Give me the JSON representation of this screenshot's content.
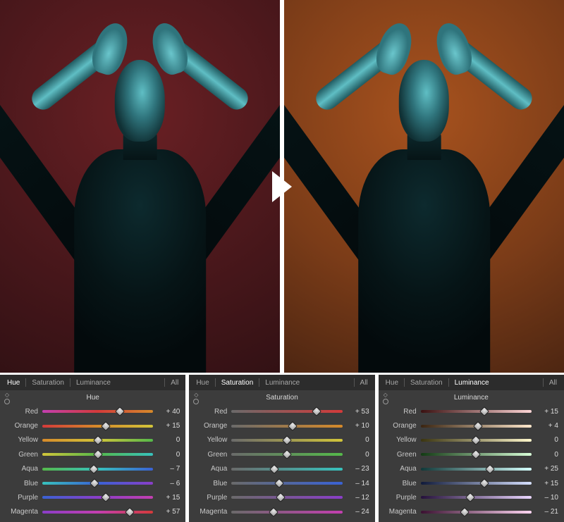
{
  "comparison_arrow": true,
  "panels": [
    {
      "tabs": [
        "Hue",
        "Saturation",
        "Luminance"
      ],
      "active_tab": "Hue",
      "all_label": "All",
      "section_title": "Hue",
      "rows": [
        {
          "label": "Red",
          "value": 40,
          "display": "+ 40"
        },
        {
          "label": "Orange",
          "value": 15,
          "display": "+ 15"
        },
        {
          "label": "Yellow",
          "value": 0,
          "display": "0"
        },
        {
          "label": "Green",
          "value": 0,
          "display": "0"
        },
        {
          "label": "Aqua",
          "value": -7,
          "display": "– 7"
        },
        {
          "label": "Blue",
          "value": -6,
          "display": "– 6"
        },
        {
          "label": "Purple",
          "value": 15,
          "display": "+ 15"
        },
        {
          "label": "Magenta",
          "value": 57,
          "display": "+ 57"
        }
      ]
    },
    {
      "tabs": [
        "Hue",
        "Saturation",
        "Luminance"
      ],
      "active_tab": "Saturation",
      "all_label": "All",
      "section_title": "Saturation",
      "rows": [
        {
          "label": "Red",
          "value": 53,
          "display": "+ 53"
        },
        {
          "label": "Orange",
          "value": 10,
          "display": "+ 10"
        },
        {
          "label": "Yellow",
          "value": 0,
          "display": "0"
        },
        {
          "label": "Green",
          "value": 0,
          "display": "0"
        },
        {
          "label": "Aqua",
          "value": -23,
          "display": "– 23"
        },
        {
          "label": "Blue",
          "value": -14,
          "display": "– 14"
        },
        {
          "label": "Purple",
          "value": -12,
          "display": "– 12"
        },
        {
          "label": "Magenta",
          "value": -24,
          "display": "– 24"
        }
      ]
    },
    {
      "tabs": [
        "Hue",
        "Saturation",
        "Luminance"
      ],
      "active_tab": "Luminance",
      "all_label": "All",
      "section_title": "Luminance",
      "rows": [
        {
          "label": "Red",
          "value": 15,
          "display": "+ 15"
        },
        {
          "label": "Orange",
          "value": 4,
          "display": "+ 4"
        },
        {
          "label": "Yellow",
          "value": 0,
          "display": "0"
        },
        {
          "label": "Green",
          "value": 0,
          "display": "0"
        },
        {
          "label": "Aqua",
          "value": 25,
          "display": "+ 25"
        },
        {
          "label": "Blue",
          "value": 15,
          "display": "+ 15"
        },
        {
          "label": "Purple",
          "value": -10,
          "display": "– 10"
        },
        {
          "label": "Magenta",
          "value": -21,
          "display": "– 21"
        }
      ]
    }
  ],
  "gradients": {
    "hue": {
      "Red": [
        "#c33fb0",
        "#d43a3a",
        "#d68a2a"
      ],
      "Orange": [
        "#d43a3a",
        "#d68a2a",
        "#d2c53a"
      ],
      "Yellow": [
        "#d68a2a",
        "#d2c53a",
        "#55b94a"
      ],
      "Green": [
        "#d2c53a",
        "#55b94a",
        "#37c2bd"
      ],
      "Aqua": [
        "#55b94a",
        "#37c2bd",
        "#3a62d4"
      ],
      "Blue": [
        "#37c2bd",
        "#3a62d4",
        "#8a3ec8"
      ],
      "Purple": [
        "#3a62d4",
        "#8a3ec8",
        "#c33fb0"
      ],
      "Magenta": [
        "#8a3ec8",
        "#c33fb0",
        "#d43a3a"
      ]
    },
    "sat": {
      "Red": [
        "#6a6a6a",
        "#d43a3a"
      ],
      "Orange": [
        "#6a6a6a",
        "#d68a2a"
      ],
      "Yellow": [
        "#6a6a6a",
        "#d2c53a"
      ],
      "Green": [
        "#6a6a6a",
        "#55b94a"
      ],
      "Aqua": [
        "#6a6a6a",
        "#37c2bd"
      ],
      "Blue": [
        "#6a6a6a",
        "#3a62d4"
      ],
      "Purple": [
        "#6a6a6a",
        "#8a3ec8"
      ],
      "Magenta": [
        "#6a6a6a",
        "#c33fb0"
      ]
    },
    "lum": {
      "Red": [
        "#3a1010",
        "#ffd6d6"
      ],
      "Orange": [
        "#3a2410",
        "#ffe8cc"
      ],
      "Yellow": [
        "#3a3410",
        "#fff8cc"
      ],
      "Green": [
        "#123a13",
        "#d8ffd8"
      ],
      "Aqua": [
        "#103838",
        "#d4fffd"
      ],
      "Blue": [
        "#101a3a",
        "#d6e0ff"
      ],
      "Purple": [
        "#24103a",
        "#ead6ff"
      ],
      "Magenta": [
        "#3a1030",
        "#ffd6f3"
      ]
    }
  },
  "image_left_alt": "before-image",
  "image_right_alt": "after-image"
}
